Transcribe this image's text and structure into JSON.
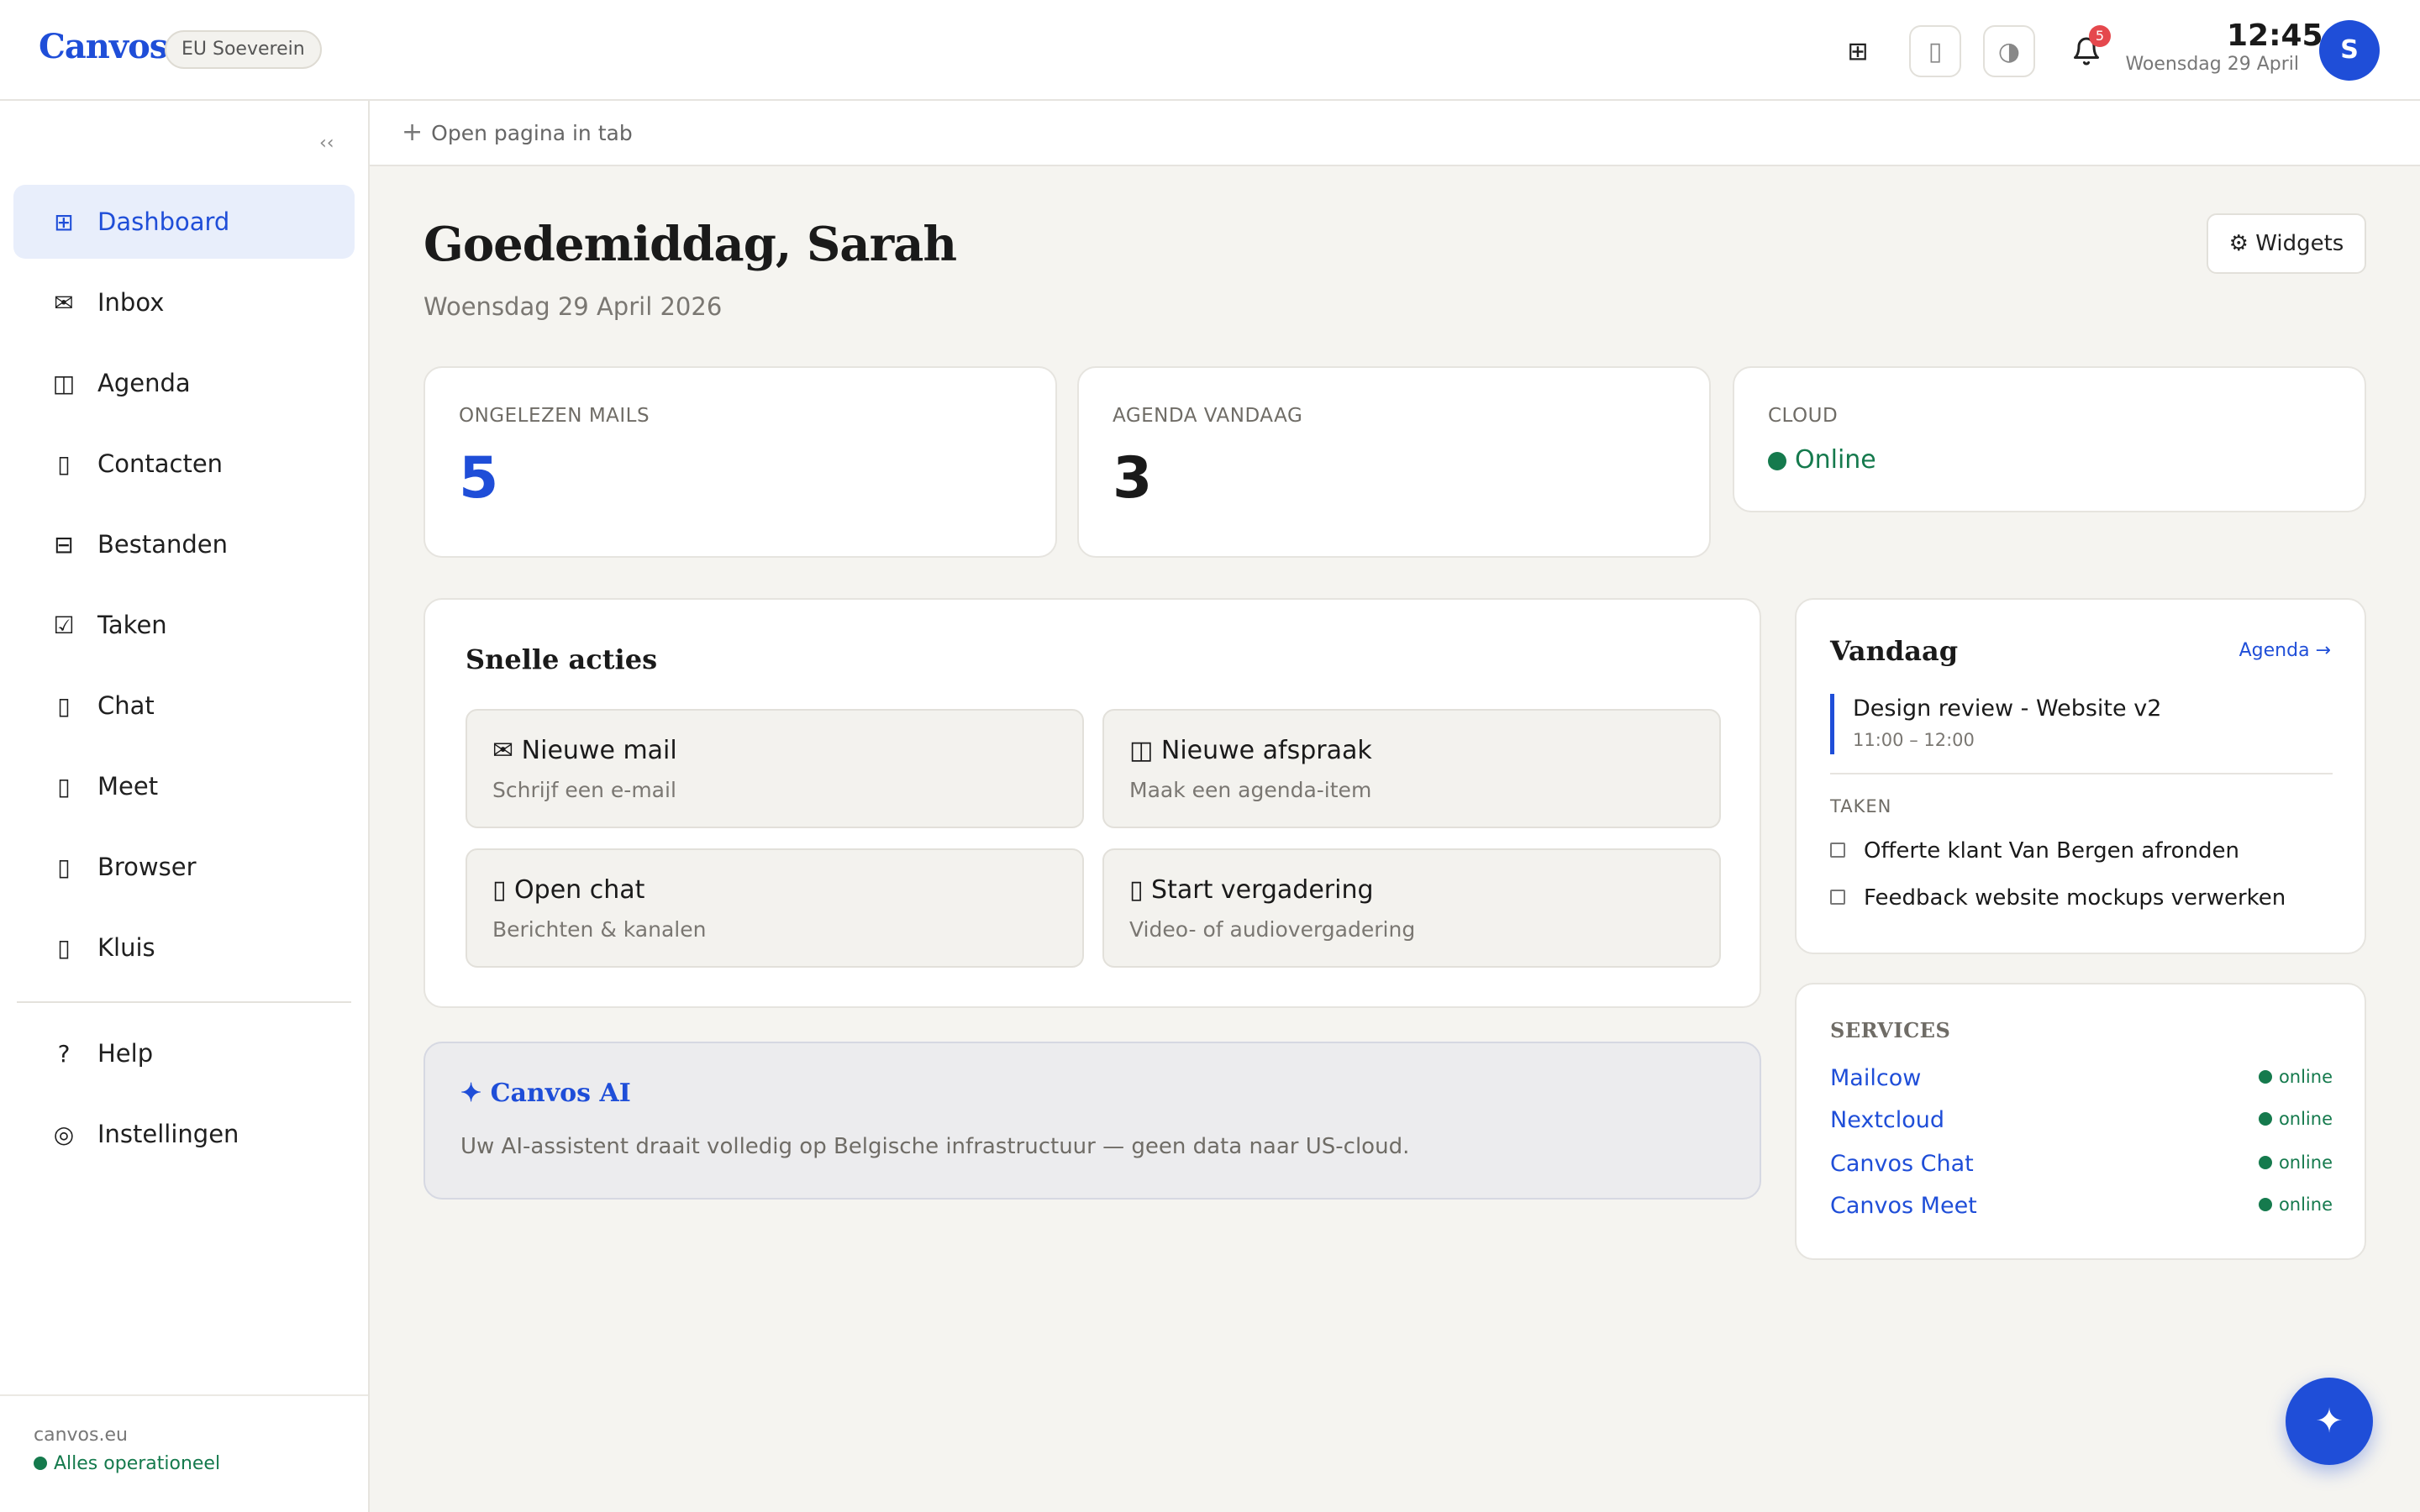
{
  "header": {
    "logo": "Canvos",
    "region_badge": "EU Soeverein",
    "apps_icon": "⊞",
    "device_icon": "▯",
    "theme_icon": "◑",
    "bell_icon": "🔔",
    "notification_count": "5",
    "time": "12:45",
    "date": "Woensdag 29 April",
    "avatar_initial": "S"
  },
  "sidebar": {
    "collapse_label": "‹‹",
    "items": [
      {
        "label": "Dashboard",
        "icon": "⊞"
      },
      {
        "label": "Inbox",
        "icon": "✉"
      },
      {
        "label": "Agenda",
        "icon": "◫"
      },
      {
        "label": "Contacten",
        "icon": "▯"
      },
      {
        "label": "Bestanden",
        "icon": "⊟"
      },
      {
        "label": "Taken",
        "icon": "☑"
      },
      {
        "label": "Chat",
        "icon": "▯"
      },
      {
        "label": "Meet",
        "icon": "▯"
      },
      {
        "label": "Browser",
        "icon": "▯"
      },
      {
        "label": "Kluis",
        "icon": "▯"
      }
    ],
    "secondary": [
      {
        "label": "Help",
        "icon": "?"
      },
      {
        "label": "Instellingen",
        "icon": "◎"
      }
    ],
    "footer": {
      "domain": "canvos.eu",
      "status": "Alles operationeel"
    }
  },
  "tabstrip": {
    "open_tab_label": "Open pagina in tab",
    "plus_icon": "+"
  },
  "main": {
    "greeting": "Goedemiddag, Sarah",
    "date": "Woensdag 29 April 2026",
    "widgets_button": "⚙ Widgets",
    "stats": [
      {
        "label": "ONGELEZEN MAILS",
        "value": "5"
      },
      {
        "label": "AGENDA VANDAAG",
        "value": "3"
      },
      {
        "label": "CLOUD",
        "value": "Online"
      }
    ],
    "quick_actions": {
      "title": "Snelle acties",
      "items": [
        {
          "title": "✉ Nieuwe mail",
          "subtitle": "Schrijf een e-mail"
        },
        {
          "title": "◫ Nieuwe afspraak",
          "subtitle": "Maak een agenda-item"
        },
        {
          "title": "▯ Open chat",
          "subtitle": "Berichten & kanalen"
        },
        {
          "title": "▯ Start vergadering",
          "subtitle": "Video- of audiovergadering"
        }
      ]
    },
    "ai": {
      "title": "✦ Canvos AI",
      "description": "Uw AI-assistent draait volledig op Belgische infrastructuur — geen data naar US-cloud."
    },
    "today": {
      "title": "Vandaag",
      "link": "Agenda →",
      "event_title": "Design review - Website v2",
      "event_time": "11:00 – 12:00",
      "tasks_label": "TAKEN",
      "tasks": [
        "Offerte klant Van Bergen afronden",
        "Feedback website mockups verwerken"
      ]
    },
    "services": {
      "title": "SERVICES",
      "items": [
        {
          "name": "Mailcow",
          "status": "online"
        },
        {
          "name": "Nextcloud",
          "status": "online"
        },
        {
          "name": "Canvos Chat",
          "status": "online"
        },
        {
          "name": "Canvos Meet",
          "status": "online"
        }
      ]
    },
    "fab_icon": "✦"
  },
  "colors": {
    "accent": "#1f4ed8",
    "success": "#157a4d",
    "background": "#f5f4f0",
    "badge": "#e5484d"
  }
}
